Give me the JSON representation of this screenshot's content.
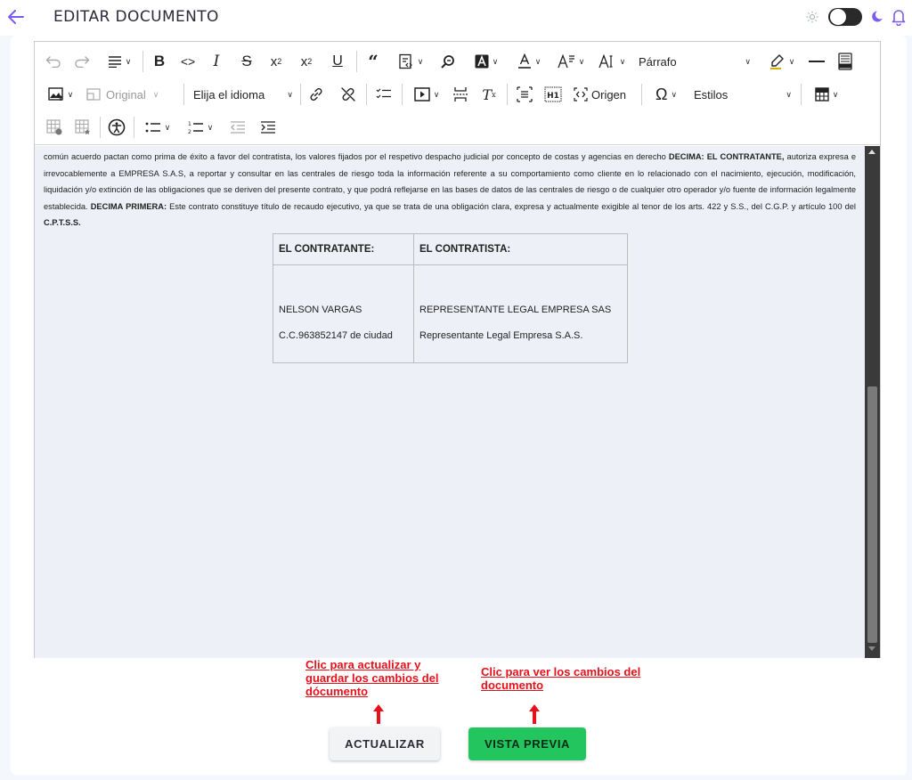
{
  "header": {
    "title": "EDITAR DOCUMENTO",
    "icons": [
      "back-arrow-icon",
      "sun-icon",
      "theme-toggle",
      "moon-icon",
      "bell-icon"
    ],
    "accent_color": "#7b5cf0"
  },
  "toolbar": {
    "image_size_label": "Original",
    "language_label": "Elija el idioma",
    "block_format_label": "Párrafo",
    "source_label": "Origen",
    "styles_label": "Estilos"
  },
  "document": {
    "paragraph_parts": [
      "común acuerdo pactan como prima de éxito a favor del contratista, los valores fijados por el respetivo despacho judicial por concepto de costas y agencias en derecho ",
      "DECIMA: EL CONTRATANTE,",
      " autoriza expresa e irrevocablemente a EMPRESA S.A.S, a reportar y consultar en las centrales de riesgo toda la información referente a su comportamiento como cliente en lo relacionado con el nacimiento, ejecución, modificación, liquidación y/o extinción de las obligaciones que se deriven del presente contrato, y que podrá reflejarse en las bases de datos de las centrales de riesgo o de cualquier otro operador y/o fuente de información legalmente establecida. ",
      "DECIMA PRIMERA:",
      " Este contrato constituye título de recaudo ejecutivo, ya que se trata de una obligación clara, expresa y actualmente exigible al tenor de los arts. 422 y S.S., del C.G.P. y artículo 100 del ",
      "C.P.T.S.S."
    ],
    "signature_table": {
      "headers": [
        "EL CONTRATANTE:",
        "EL CONTRATISTA:"
      ],
      "names": [
        "NELSON VARGAS",
        "REPRESENTANTE LEGAL EMPRESA SAS"
      ],
      "ids": [
        "C.C.963852147 de ciudad",
        "Representante Legal Empresa S.A.S."
      ]
    }
  },
  "annotations": {
    "update_hint": "Clic para actualizar y guardar los cambios del dócumento",
    "preview_hint": "Clic para ver los cambios del documento",
    "color": "#e8101a"
  },
  "actions": {
    "update_label": "ACTUALIZAR",
    "preview_label": "VISTA PREVIA",
    "preview_color": "#22c55e"
  }
}
